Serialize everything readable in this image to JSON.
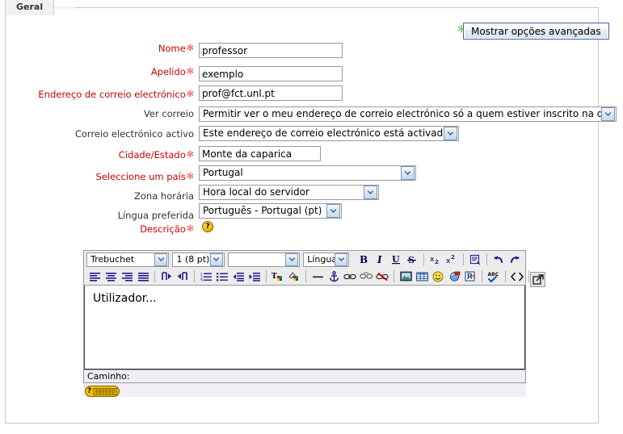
{
  "tab": {
    "label": "Geral"
  },
  "advanced_button": {
    "label": "Mostrar opções avançadas",
    "marker": "✻"
  },
  "fields": {
    "nome": {
      "label": "Nome",
      "required": true,
      "value": "professor"
    },
    "apelido": {
      "label": "Apelido",
      "required": true,
      "value": "exemplo"
    },
    "email": {
      "label": "Endereço de correio electrónico",
      "required": true,
      "value": "prof@fct.unl.pt"
    },
    "ver_correio": {
      "label": "Ver correio",
      "required": false,
      "value": "Permitir ver o meu endereço de correio electrónico só a quem estiver inscrito na disciplina"
    },
    "email_activo": {
      "label": "Correio electrónico activo",
      "required": false,
      "value": "Este endereço de correio electrónico está activado"
    },
    "cidade": {
      "label": "Cidade/Estado",
      "required": true,
      "value": "Monte da caparica"
    },
    "pais": {
      "label": "Seleccione um país",
      "required": true,
      "value": "Portugal"
    },
    "zona": {
      "label": "Zona horária",
      "required": false,
      "value": "Hora local do servidor"
    },
    "lingua": {
      "label": "Língua preferida",
      "required": false,
      "value": "Português - Portugal (pt)"
    },
    "descricao": {
      "label": "Descrição",
      "required": true,
      "help": "?"
    }
  },
  "editor": {
    "font_family": "Trebuchet",
    "font_size": "1 (8 pt)",
    "format": "",
    "language": "Língua",
    "content": "Utilizador...",
    "path_label": "Caminho:",
    "keyboard_help": "?",
    "toolbar_row1": [
      "font-family-select",
      "font-size-select",
      "format-select",
      "language-select",
      "bold-icon",
      "italic-icon",
      "underline-icon",
      "strikethrough-icon",
      "subscript-icon",
      "superscript-icon",
      "cleanup-icon",
      "undo-icon",
      "redo-icon"
    ],
    "toolbar_row2": [
      "align-left-icon",
      "align-center-icon",
      "align-right-icon",
      "align-justify-icon",
      "ltr-icon",
      "rtl-icon",
      "ordered-list-icon",
      "unordered-list-icon",
      "outdent-icon",
      "indent-icon",
      "text-color-icon",
      "background-color-icon",
      "horizontal-rule-icon",
      "anchor-icon",
      "insert-link-icon",
      "unlink-icon",
      "remove-link-icon",
      "insert-image-icon",
      "insert-table-icon",
      "smiley-icon",
      "media-icon",
      "insert-file-icon",
      "spellcheck-icon",
      "source-code-icon",
      "fullscreen-icon"
    ]
  },
  "colors": {
    "required_label": "#cc0000",
    "asterisk": "#ff4d4d",
    "green_marker": "#6abf4b",
    "button_border": "#36659c",
    "toolbar_bg": "#ececed",
    "help_yellow": "#f5c400"
  }
}
